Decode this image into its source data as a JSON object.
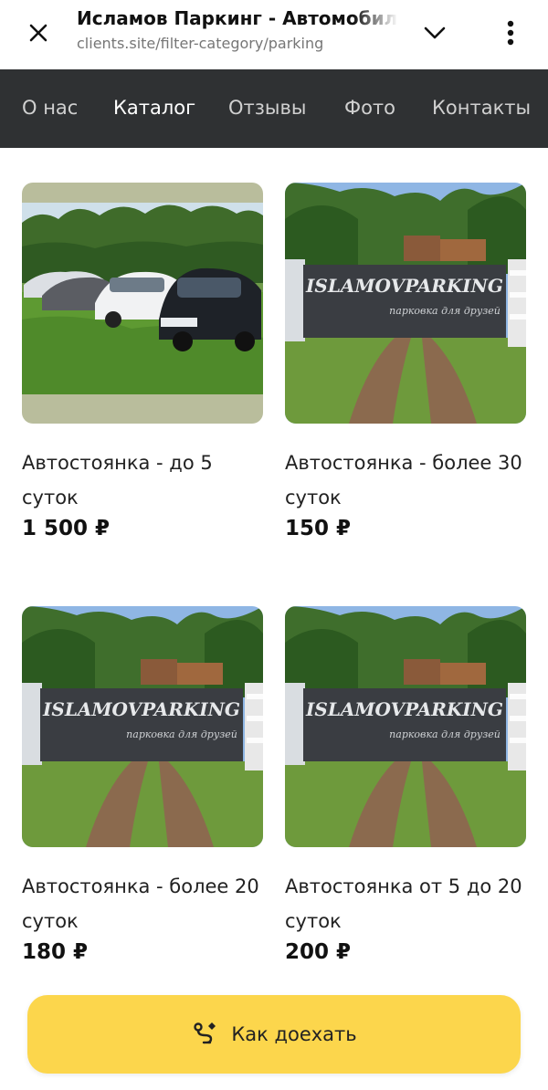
{
  "browser": {
    "title": "Исламов Паркинг - Автомобильная стоянка",
    "url": "clients.site/filter-category/parking",
    "close_icon": "close-icon",
    "chevron_icon": "chevron-down-icon",
    "menu_icon": "more-vertical-icon"
  },
  "nav": {
    "items": [
      {
        "label": "О нас",
        "active": false
      },
      {
        "label": "Каталог",
        "active": true
      },
      {
        "label": "Отзывы",
        "active": false
      },
      {
        "label": "Фото",
        "active": false
      },
      {
        "label": "Контакты",
        "active": false
      }
    ]
  },
  "products": [
    {
      "name": "Автостоянка - до 5 суток",
      "price": "1 500 ₽",
      "photo": "parked-cars-photo"
    },
    {
      "name": "Автостоянка - более 30 суток",
      "price": "150 ₽",
      "photo": "parking-gate-sign-photo"
    },
    {
      "name": "Автостоянка - более 20 суток",
      "price": "180 ₽",
      "photo": "parking-gate-sign-photo"
    },
    {
      "name": "Автостоянка от 5 до 20 суток",
      "price": "200 ₽",
      "photo": "parking-gate-sign-photo"
    }
  ],
  "sign": {
    "brand": "ISLAMOVPARKING",
    "tagline": "парковка для друзей"
  },
  "cta": {
    "label": "Как доехать",
    "icon": "route-icon"
  },
  "colors": {
    "nav_background": "#2f3133",
    "cta_background": "#fcd64c"
  }
}
